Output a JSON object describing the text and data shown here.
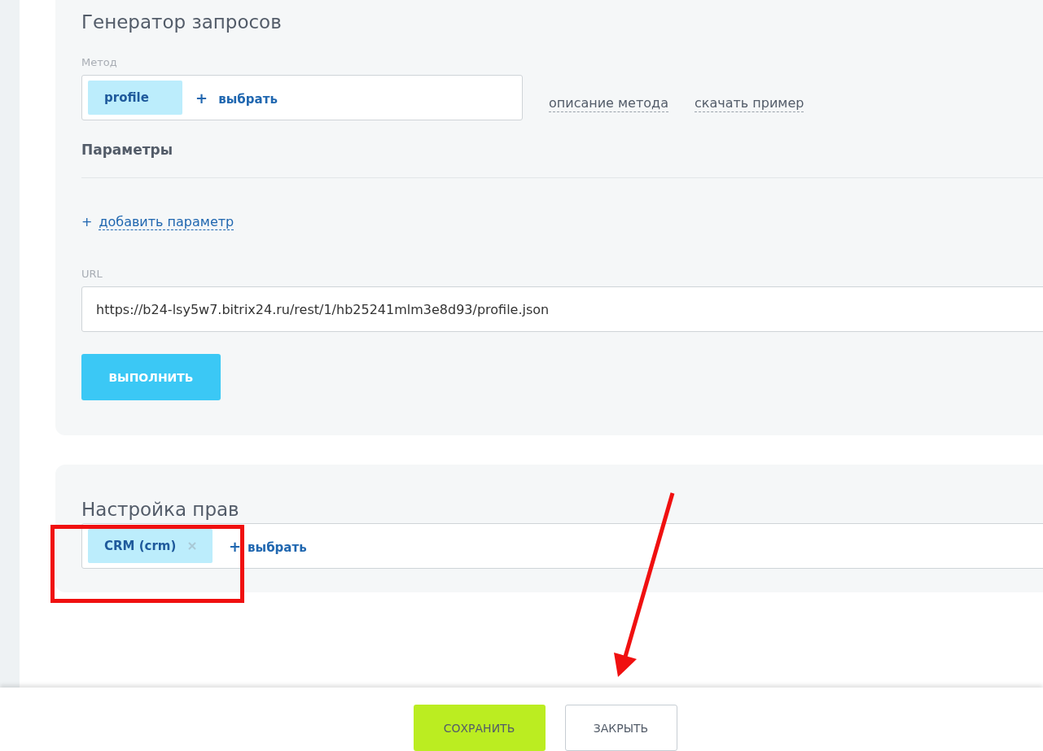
{
  "request_generator": {
    "title": "Генератор запросов",
    "method_label": "Метод",
    "method_tags": [
      {
        "label": "profile",
        "removable": false
      }
    ],
    "method_add": {
      "icon": "+",
      "label": "выбрать"
    },
    "links": [
      "описание метода",
      "скачать пример"
    ],
    "params_title": "Параметры",
    "add_param": {
      "icon": "+",
      "label": "добавить параметр"
    },
    "url_label": "URL",
    "url_value": "https://b24-lsy5w7.bitrix24.ru/rest/1/hb25241mlm3e8d93/profile.json",
    "run_button": "ВЫПОЛНИТЬ"
  },
  "rights": {
    "title": "Настройка прав",
    "tags": [
      {
        "label": "CRM (crm)",
        "removable": true
      }
    ],
    "add": {
      "icon": "+",
      "label": "выбрать"
    }
  },
  "footer": {
    "buttons": [
      {
        "label": "СОХРАНИТЬ",
        "kind": "primary"
      },
      {
        "label": "ЗАКРЫТЬ",
        "kind": "secondary"
      }
    ]
  },
  "annotations": [
    {
      "kind": "rectangle"
    },
    {
      "kind": "arrow"
    }
  ]
}
